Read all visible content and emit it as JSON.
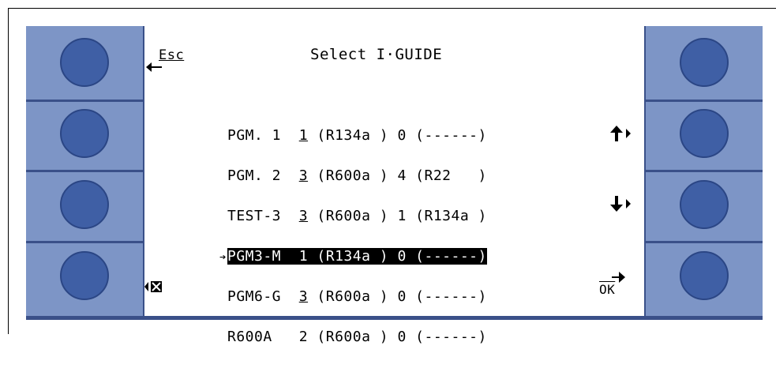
{
  "screen": {
    "title": "Select I·GUIDE",
    "esc_label": "Esc",
    "ok_label": "OK",
    "programs": [
      {
        "name": "PGM. 1",
        "num": "1",
        "gas": "(R134a )",
        "count": "0",
        "alt": "(------)",
        "selected": false
      },
      {
        "name": "PGM. 2",
        "num": "3",
        "gas": "(R600a )",
        "count": "4",
        "alt": "(R22   )",
        "selected": false
      },
      {
        "name": "TEST-3",
        "num": "3",
        "gas": "(R600a )",
        "count": "1",
        "alt": "(R134a )",
        "selected": false
      },
      {
        "name": "PGM3-M",
        "num": "1",
        "gas": "(R134a )",
        "count": "0",
        "alt": "(------)",
        "selected": true
      },
      {
        "name": "PGM6-G",
        "num": "3",
        "gas": "(R600a )",
        "count": "0",
        "alt": "(------)",
        "selected": false
      },
      {
        "name": "R600A ",
        "num": "2",
        "gas": "(R600a )",
        "count": "0",
        "alt": "(------)",
        "selected": false
      }
    ]
  },
  "icons": {
    "esc": "back-arrow-icon",
    "up": "arrow-up-icon",
    "down": "arrow-down-icon",
    "delete": "delete-x-icon",
    "ok": "enter-arrow-icon",
    "pointer": "selection-pointer-icon"
  },
  "colors": {
    "panel": "#7d95c6",
    "softkey": "#3f5fa5",
    "separator": "#3a5089"
  }
}
